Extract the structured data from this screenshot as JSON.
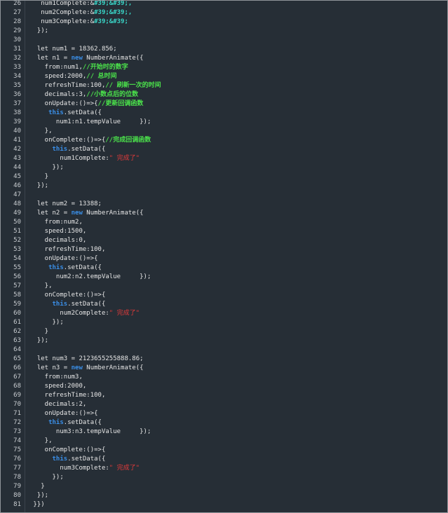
{
  "theme": {
    "background": "#262e36",
    "text": "#e6e6e6",
    "keyword": "#3a8fe8",
    "comment": "#4be34b",
    "entity": "#39d3c5",
    "string": "#e03a3a",
    "line_number": "#c8ccd0"
  },
  "lines": [
    {
      "n": "26",
      "tokens": [
        {
          "t": "   num1Complete:&",
          "c": "plain"
        },
        {
          "t": "#39;&#39;,",
          "c": "ent"
        }
      ]
    },
    {
      "n": "27",
      "tokens": [
        {
          "t": "   num2Complete:&",
          "c": "plain"
        },
        {
          "t": "#39;&#39;,",
          "c": "ent"
        }
      ]
    },
    {
      "n": "28",
      "tokens": [
        {
          "t": "   num3Complete:&",
          "c": "plain"
        },
        {
          "t": "#39;&#39;",
          "c": "ent"
        }
      ]
    },
    {
      "n": "29",
      "tokens": [
        {
          "t": "  });",
          "c": "plain"
        }
      ]
    },
    {
      "n": "30",
      "tokens": []
    },
    {
      "n": "31",
      "tokens": [
        {
          "t": "  let num1 = 18362.856;",
          "c": "plain"
        }
      ]
    },
    {
      "n": "32",
      "tokens": [
        {
          "t": "  let n1 = ",
          "c": "plain"
        },
        {
          "t": "new",
          "c": "kw"
        },
        {
          "t": " NumberAnimate({",
          "c": "plain"
        }
      ]
    },
    {
      "n": "33",
      "tokens": [
        {
          "t": "    from:num1,",
          "c": "plain"
        },
        {
          "t": "//开始时的数字",
          "c": "cm"
        }
      ]
    },
    {
      "n": "34",
      "tokens": [
        {
          "t": "    speed:2000,",
          "c": "plain"
        },
        {
          "t": "// 总时间",
          "c": "cm"
        }
      ]
    },
    {
      "n": "35",
      "tokens": [
        {
          "t": "    refreshTime:100,",
          "c": "plain"
        },
        {
          "t": "// 刷新一次的时间",
          "c": "cm"
        }
      ]
    },
    {
      "n": "36",
      "tokens": [
        {
          "t": "    decimals:3,",
          "c": "plain"
        },
        {
          "t": "//小数点后的位数",
          "c": "cm"
        }
      ]
    },
    {
      "n": "37",
      "tokens": [
        {
          "t": "    onUpdate:()=>{",
          "c": "plain"
        },
        {
          "t": "//更新回调函数",
          "c": "cm"
        }
      ]
    },
    {
      "n": "38",
      "tokens": [
        {
          "t": "     ",
          "c": "plain"
        },
        {
          "t": "this",
          "c": "kw"
        },
        {
          "t": ".setData({",
          "c": "plain"
        }
      ]
    },
    {
      "n": "39",
      "tokens": [
        {
          "t": "       num1:n1.tempValue     });",
          "c": "plain"
        }
      ]
    },
    {
      "n": "40",
      "tokens": [
        {
          "t": "    },",
          "c": "plain"
        }
      ]
    },
    {
      "n": "41",
      "tokens": [
        {
          "t": "    onComplete:()=>{",
          "c": "plain"
        },
        {
          "t": "//完成回调函数",
          "c": "cm"
        }
      ]
    },
    {
      "n": "42",
      "tokens": [
        {
          "t": "      ",
          "c": "plain"
        },
        {
          "t": "this",
          "c": "kw"
        },
        {
          "t": ".setData({",
          "c": "plain"
        }
      ]
    },
    {
      "n": "43",
      "tokens": [
        {
          "t": "        num1Complete:",
          "c": "plain"
        },
        {
          "t": "\" 完成了\"",
          "c": "str"
        }
      ]
    },
    {
      "n": "44",
      "tokens": [
        {
          "t": "      });",
          "c": "plain"
        }
      ]
    },
    {
      "n": "45",
      "tokens": [
        {
          "t": "    }",
          "c": "plain"
        }
      ]
    },
    {
      "n": "46",
      "tokens": [
        {
          "t": "  });",
          "c": "plain"
        }
      ]
    },
    {
      "n": "47",
      "tokens": []
    },
    {
      "n": "48",
      "tokens": [
        {
          "t": "  let num2 = 13388;",
          "c": "plain"
        }
      ]
    },
    {
      "n": "49",
      "tokens": [
        {
          "t": "  let n2 = ",
          "c": "plain"
        },
        {
          "t": "new",
          "c": "kw"
        },
        {
          "t": " NumberAnimate({",
          "c": "plain"
        }
      ]
    },
    {
      "n": "50",
      "tokens": [
        {
          "t": "    from:num2,",
          "c": "plain"
        }
      ]
    },
    {
      "n": "51",
      "tokens": [
        {
          "t": "    speed:1500,",
          "c": "plain"
        }
      ]
    },
    {
      "n": "52",
      "tokens": [
        {
          "t": "    decimals:0,",
          "c": "plain"
        }
      ]
    },
    {
      "n": "53",
      "tokens": [
        {
          "t": "    refreshTime:100,",
          "c": "plain"
        }
      ]
    },
    {
      "n": "54",
      "tokens": [
        {
          "t": "    onUpdate:()=>{",
          "c": "plain"
        }
      ]
    },
    {
      "n": "55",
      "tokens": [
        {
          "t": "     ",
          "c": "plain"
        },
        {
          "t": "this",
          "c": "kw"
        },
        {
          "t": ".setData({",
          "c": "plain"
        }
      ]
    },
    {
      "n": "56",
      "tokens": [
        {
          "t": "       num2:n2.tempValue     });",
          "c": "plain"
        }
      ]
    },
    {
      "n": "57",
      "tokens": [
        {
          "t": "    },",
          "c": "plain"
        }
      ]
    },
    {
      "n": "58",
      "tokens": [
        {
          "t": "    onComplete:()=>{",
          "c": "plain"
        }
      ]
    },
    {
      "n": "59",
      "tokens": [
        {
          "t": "      ",
          "c": "plain"
        },
        {
          "t": "this",
          "c": "kw"
        },
        {
          "t": ".setData({",
          "c": "plain"
        }
      ]
    },
    {
      "n": "60",
      "tokens": [
        {
          "t": "        num2Complete:",
          "c": "plain"
        },
        {
          "t": "\" 完成了\"",
          "c": "str"
        }
      ]
    },
    {
      "n": "61",
      "tokens": [
        {
          "t": "      });",
          "c": "plain"
        }
      ]
    },
    {
      "n": "62",
      "tokens": [
        {
          "t": "    }",
          "c": "plain"
        }
      ]
    },
    {
      "n": "63",
      "tokens": [
        {
          "t": "  });",
          "c": "plain"
        }
      ]
    },
    {
      "n": "64",
      "tokens": []
    },
    {
      "n": "65",
      "tokens": [
        {
          "t": "  let num3 = 2123655255888.86;",
          "c": "plain"
        }
      ]
    },
    {
      "n": "66",
      "tokens": [
        {
          "t": "  let n3 = ",
          "c": "plain"
        },
        {
          "t": "new",
          "c": "kw"
        },
        {
          "t": " NumberAnimate({",
          "c": "plain"
        }
      ]
    },
    {
      "n": "67",
      "tokens": [
        {
          "t": "    from:num3,",
          "c": "plain"
        }
      ]
    },
    {
      "n": "68",
      "tokens": [
        {
          "t": "    speed:2000,",
          "c": "plain"
        }
      ]
    },
    {
      "n": "69",
      "tokens": [
        {
          "t": "    refreshTime:100,",
          "c": "plain"
        }
      ]
    },
    {
      "n": "70",
      "tokens": [
        {
          "t": "    decimals:2,",
          "c": "plain"
        }
      ]
    },
    {
      "n": "71",
      "tokens": [
        {
          "t": "    onUpdate:()=>{",
          "c": "plain"
        }
      ]
    },
    {
      "n": "72",
      "tokens": [
        {
          "t": "     ",
          "c": "plain"
        },
        {
          "t": "this",
          "c": "kw"
        },
        {
          "t": ".setData({",
          "c": "plain"
        }
      ]
    },
    {
      "n": "73",
      "tokens": [
        {
          "t": "       num3:n3.tempValue     });",
          "c": "plain"
        }
      ]
    },
    {
      "n": "74",
      "tokens": [
        {
          "t": "    },",
          "c": "plain"
        }
      ]
    },
    {
      "n": "75",
      "tokens": [
        {
          "t": "    onComplete:()=>{",
          "c": "plain"
        }
      ]
    },
    {
      "n": "76",
      "tokens": [
        {
          "t": "      ",
          "c": "plain"
        },
        {
          "t": "this",
          "c": "kw"
        },
        {
          "t": ".setData({",
          "c": "plain"
        }
      ]
    },
    {
      "n": "77",
      "tokens": [
        {
          "t": "        num3Complete:",
          "c": "plain"
        },
        {
          "t": "\" 完成了\"",
          "c": "str"
        }
      ]
    },
    {
      "n": "78",
      "tokens": [
        {
          "t": "      });",
          "c": "plain"
        }
      ]
    },
    {
      "n": "79",
      "tokens": [
        {
          "t": "   }",
          "c": "plain"
        }
      ]
    },
    {
      "n": "80",
      "tokens": [
        {
          "t": "  });",
          "c": "plain"
        }
      ]
    },
    {
      "n": "81",
      "tokens": [
        {
          "t": " }})",
          "c": "plain"
        }
      ]
    }
  ]
}
